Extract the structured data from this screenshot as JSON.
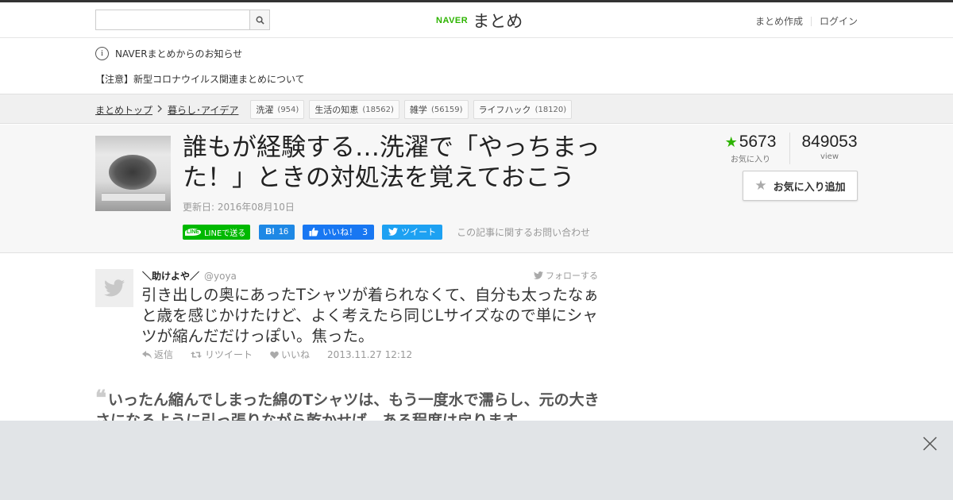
{
  "header": {
    "search": {
      "value": "",
      "placeholder": ""
    },
    "logo": {
      "brand": "NAVER",
      "name": "まとめ"
    },
    "links": {
      "create": "まとめ作成",
      "login": "ログイン"
    }
  },
  "notice": {
    "heading": "NAVERまとめからのお知らせ",
    "link": "【注意】新型コロナウイルス関連まとめについて"
  },
  "breadcrumb": {
    "items": [
      "まとめトップ",
      "暮らし･アイデア"
    ],
    "tags": [
      {
        "label": "洗濯",
        "count": "(954)"
      },
      {
        "label": "生活の知恵",
        "count": "(18562)"
      },
      {
        "label": "雑学",
        "count": "(56159)"
      },
      {
        "label": "ライフハック",
        "count": "(18120)"
      }
    ]
  },
  "article": {
    "title": "誰もが経験する…洗濯で「やっちまった！」ときの対処法を覚えておこう",
    "updated": "更新日: 2016年08月10日",
    "social": {
      "line": "LINEで送る",
      "line_icon": "LINE",
      "hatena_mark": "B!",
      "hatena_count": "16",
      "fb_label": "いいね！",
      "fb_count": "3",
      "tweet": "ツイート",
      "contact": "この記事に関するお問い合わせ"
    },
    "stats": {
      "favorites": "5673",
      "favorites_label": "お気に入り",
      "views": "849053",
      "views_label": "view"
    },
    "fav_button": "お気に入り追加"
  },
  "tweet": {
    "name": "＼助けよや／",
    "handle": "@yoya",
    "follow": "フォローする",
    "text": "引き出しの奥にあったTシャツが着られなくて、自分も太ったなぁと歳を感じかけたけど、よく考えたら同じLサイズなので単にシャツが縮んだだけっぽい。焦った。",
    "reply": "返信",
    "retweet": "リツイート",
    "like": "いいね",
    "date": "2013.11.27 12:12"
  },
  "quote": {
    "text": "いったん縮んでしまった綿のTシャツは、もう一度水で濡らし、元の大きさになるように引っ張りながら乾かせば、ある程度は戻ります。"
  },
  "colors": {
    "naver_green": "#2db400",
    "line_green": "#00b900",
    "hatena_blue": "#1e88e5",
    "facebook_blue": "#1877f2",
    "twitter_blue": "#1da1f2",
    "overlay_gray": "#e1e4e7"
  },
  "icons": [
    "search-icon",
    "info-icon",
    "chevron-right-icon",
    "star-icon",
    "twitter-bird-icon",
    "reply-icon",
    "retweet-icon",
    "heart-icon",
    "quote-icon",
    "close-icon"
  ]
}
